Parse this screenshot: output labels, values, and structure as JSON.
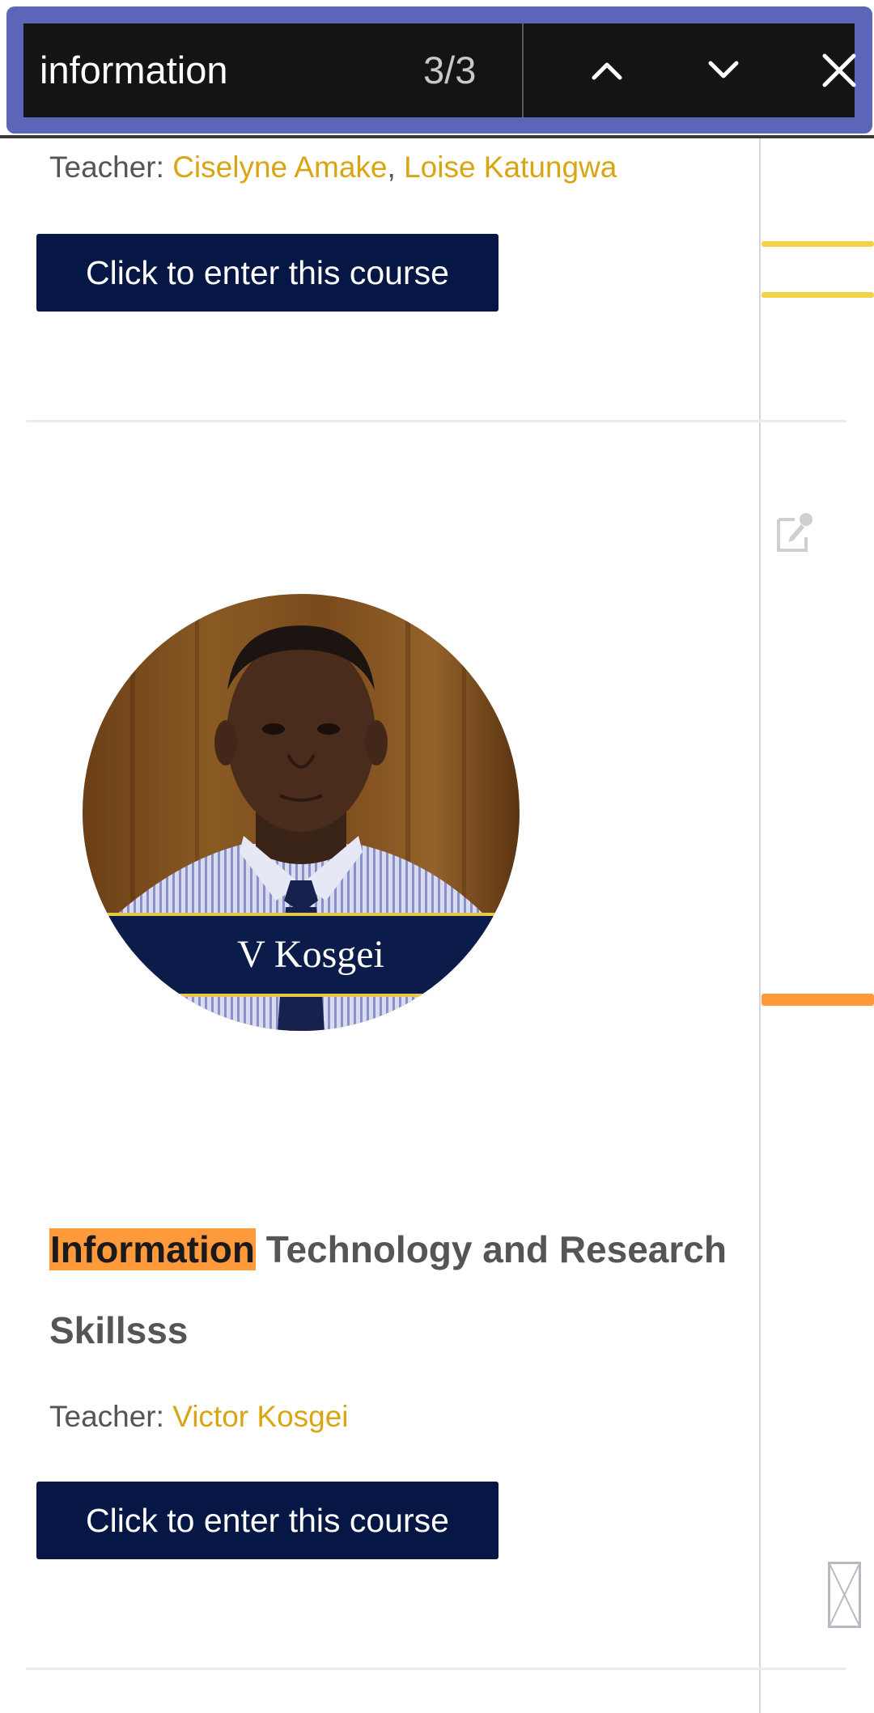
{
  "find_bar": {
    "query": "information",
    "match_count": "3/3",
    "prev_icon": "chevron-up-icon",
    "next_icon": "chevron-down-icon",
    "close_icon": "close-icon"
  },
  "scroll_markers": {
    "highlight_color": "#f3d24a",
    "active_color": "#ff9a3c"
  },
  "courses": [
    {
      "teacher_label": "Teacher:",
      "teachers": [
        "Ciselyne Amake",
        "Loise Katungwa"
      ],
      "teacher_separator": ",",
      "button_label": "Click to enter this course"
    },
    {
      "image_caption": "V Kosgei",
      "title_match": "Information",
      "title_rest_line1": " Technology and Research",
      "title_rest_line2": "Skillsss",
      "teacher_label": "Teacher:",
      "teachers": [
        "Victor Kosgei"
      ],
      "button_label": "Click to enter this course"
    }
  ],
  "colors": {
    "button_bg": "#061745",
    "link": "#d9a514",
    "find_frame": "#5b66b8",
    "match_highlight": "#ff9a3c"
  }
}
